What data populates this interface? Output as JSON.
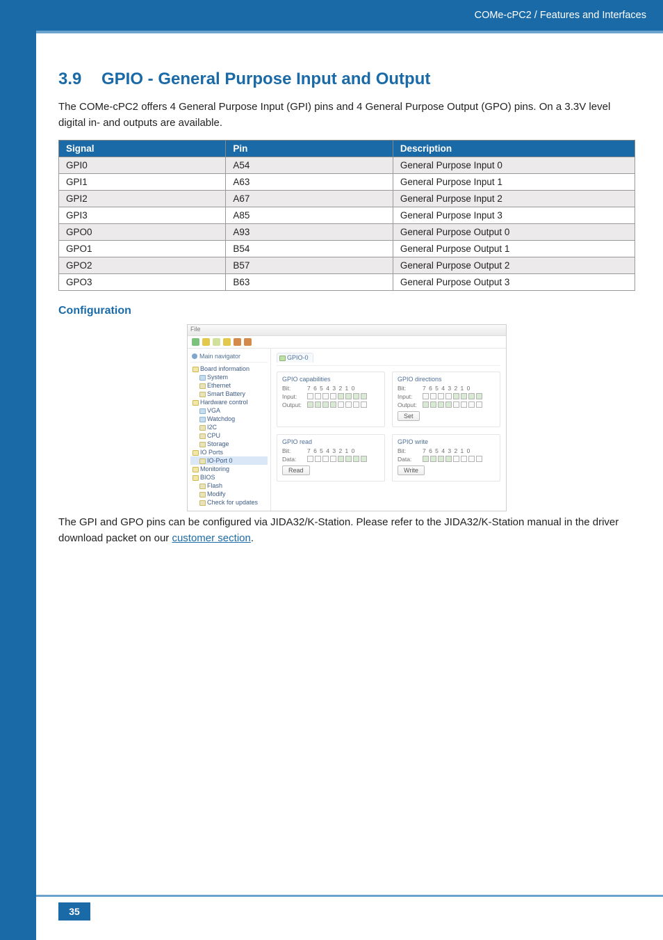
{
  "header": {
    "breadcrumb": "COMe-cPC2 / Features and Interfaces"
  },
  "section": {
    "number": "3.9",
    "title": "GPIO - General Purpose Input and Output",
    "intro": "The COMe-cPC2 offers 4 General Purpose Input (GPI) pins and 4 General Purpose Output (GPO) pins. On a 3.3V level digital in- and outputs are available."
  },
  "table": {
    "headers": {
      "signal": "Signal",
      "pin": "Pin",
      "description": "Description"
    },
    "rows": [
      {
        "signal": "GPI0",
        "pin": "A54",
        "description": "General Purpose Input 0"
      },
      {
        "signal": "GPI1",
        "pin": "A63",
        "description": "General Purpose Input 1"
      },
      {
        "signal": "GPI2",
        "pin": "A67",
        "description": "General Purpose Input 2"
      },
      {
        "signal": "GPI3",
        "pin": "A85",
        "description": "General Purpose Input 3"
      },
      {
        "signal": "GPO0",
        "pin": "A93",
        "description": "General Purpose Output 0"
      },
      {
        "signal": "GPO1",
        "pin": "B54",
        "description": "General Purpose Output 1"
      },
      {
        "signal": "GPO2",
        "pin": "B57",
        "description": "General Purpose Output 2"
      },
      {
        "signal": "GPO3",
        "pin": "B63",
        "description": "General Purpose Output 3"
      }
    ]
  },
  "config": {
    "heading": "Configuration",
    "after_text_1": "The GPI and GPO pins can be configured via JIDA32/K-Station. Please refer to the JIDA32/K-Station manual in the driver download packet on our ",
    "link_text": "customer section",
    "after_text_2": "."
  },
  "screenshot": {
    "menu_file": "File",
    "nav_title": "Main navigator",
    "tab_label": "GPIO-0",
    "nav_items": [
      "Board information",
      "System",
      "Ethernet",
      "Smart Battery",
      "Hardware control",
      "VGA",
      "Watchdog",
      "I2C",
      "CPU",
      "Storage",
      "IO Ports",
      "IO-Port 0",
      "Monitoring",
      "BIOS",
      "Flash",
      "Modify",
      "Check for updates"
    ],
    "panels": {
      "caps": {
        "title": "GPIO capabilities",
        "bits_label": "Bit:",
        "bits": "7  6  5  4  3  2  1  0",
        "input": "Input:",
        "output": "Output:"
      },
      "dirs": {
        "title": "GPIO directions",
        "bits_label": "Bit:",
        "bits": "7  6  5  4  3  2  1  0",
        "input": "Input:",
        "output": "Output:",
        "btn": "Set"
      },
      "read": {
        "title": "GPIO read",
        "bits_label": "Bit:",
        "bits": "7  6  5  4  3  2  1  0",
        "data": "Data:",
        "btn": "Read"
      },
      "write": {
        "title": "GPIO write",
        "bits_label": "Bit:",
        "bits": "7  6  5  4  3  2  1  0",
        "data": "Data:",
        "btn": "Write"
      }
    }
  },
  "page_number": "35",
  "colors": {
    "brand": "#1a6aa8"
  },
  "icons": {
    "toolbar": [
      "#7cc27c",
      "#e2c84d",
      "#cfe19b",
      "#e2c84d",
      "#d48a4a",
      "#d48a4a"
    ]
  }
}
